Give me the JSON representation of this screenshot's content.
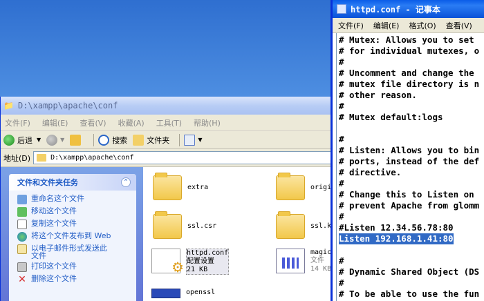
{
  "explorer": {
    "title": "D:\\xampp\\apache\\conf",
    "menu": [
      "文件(F)",
      "编辑(E)",
      "查看(V)",
      "收藏(A)",
      "工具(T)",
      "帮助(H)"
    ],
    "toolbar": {
      "back": "后退",
      "search": "搜索",
      "folders": "文件夹"
    },
    "address_label": "地址(D)",
    "address_value": "D:\\xampp\\apache\\conf",
    "tasks_header": "文件和文件夹任务",
    "tasks": [
      {
        "label": "重命名这个文件",
        "icon": "rename-icon"
      },
      {
        "label": "移动这个文件",
        "icon": "move-icon"
      },
      {
        "label": "复制这个文件",
        "icon": "copy-icon"
      },
      {
        "label": "将这个文件发布到 Web",
        "icon": "web-publish-icon"
      },
      {
        "label": "以电子邮件形式发送此\n文件",
        "icon": "email-icon"
      },
      {
        "label": "打印这个文件",
        "icon": "print-icon"
      },
      {
        "label": "删除这个文件",
        "icon": "delete-icon"
      }
    ],
    "files": [
      {
        "name": "extra",
        "type": "folder"
      },
      {
        "name": "origi",
        "type": "folder"
      },
      {
        "name": "ssl.csr",
        "type": "folder"
      },
      {
        "name": "ssl.ke",
        "type": "folder"
      },
      {
        "name": "httpd.conf",
        "desc": "配置设置",
        "size": "21 KB",
        "type": "conf"
      },
      {
        "name": "magic",
        "desc": "文件",
        "size": "14 KB",
        "type": "magic"
      },
      {
        "name": "openssl",
        "desc": "",
        "type": "app"
      }
    ]
  },
  "notepad": {
    "title": "httpd.conf - 记事本",
    "menu": [
      "文件(F)",
      "编辑(E)",
      "格式(O)",
      "查看(V)"
    ],
    "lines": [
      "# Mutex: Allows you to set",
      "# for individual mutexes, o",
      "#",
      "# Uncomment and change the",
      "# mutex file directory is n",
      "# other reason.",
      "#",
      "# Mutex default:logs",
      "",
      "#",
      "# Listen: Allows you to bin",
      "# ports, instead of the def",
      "# directive.",
      "#",
      "# Change this to Listen on",
      "# prevent Apache from glomm",
      "#",
      "#Listen 12.34.56.78:80",
      "Listen 192.168.1.41:80",
      "",
      "#",
      "# Dynamic Shared Object (DS",
      "#",
      "# To be able to use the fun"
    ],
    "highlight_line": 18
  }
}
